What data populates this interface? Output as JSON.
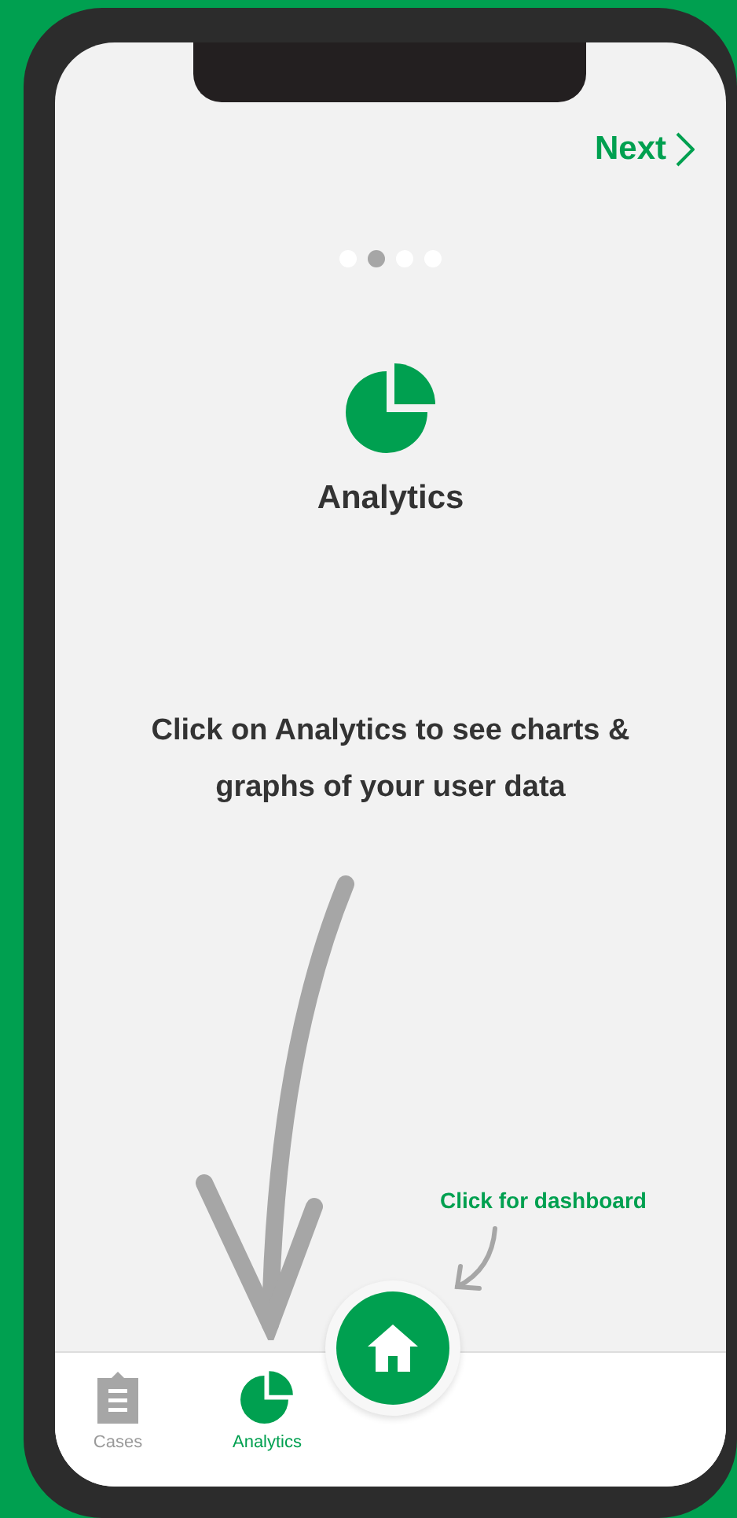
{
  "next_button": {
    "label": "Next"
  },
  "pager_dots": [
    {
      "selected": false
    },
    {
      "selected": true
    },
    {
      "selected": false
    },
    {
      "selected": false
    }
  ],
  "feature": {
    "title": "Analytics",
    "description": "Click on Analytics to see charts & graphs of your user data"
  },
  "hint": "Click for dashboard",
  "tab_bar": [
    {
      "kind": "clipboard",
      "label": "Cases",
      "selected": false
    },
    {
      "kind": "pie",
      "label": "Analytics",
      "selected": true
    }
  ]
}
